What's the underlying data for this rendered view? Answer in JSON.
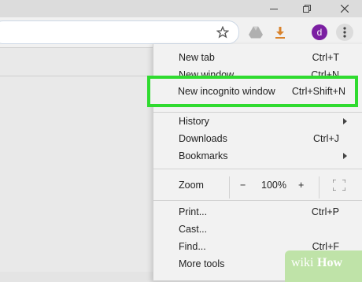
{
  "window": {
    "minimize_icon": "minimize-icon",
    "restore_icon": "restore-icon",
    "close_icon": "close-icon"
  },
  "toolbar": {
    "bookmark_icon": "star-icon",
    "extension_icon": "drive-icon",
    "download_icon": "download-icon",
    "avatar_letter": "d",
    "menu_icon": "kebab-menu-icon"
  },
  "menu": {
    "new_tab": {
      "label": "New tab",
      "shortcut": "Ctrl+T"
    },
    "new_window": {
      "label": "New window",
      "shortcut": "Ctrl+N"
    },
    "new_incognito": {
      "label": "New incognito window",
      "shortcut": "Ctrl+Shift+N"
    },
    "history": {
      "label": "History"
    },
    "downloads": {
      "label": "Downloads",
      "shortcut": "Ctrl+J"
    },
    "bookmarks": {
      "label": "Bookmarks"
    },
    "zoom": {
      "label": "Zoom",
      "minus": "−",
      "value": "100%",
      "plus": "+"
    },
    "print": {
      "label": "Print...",
      "shortcut": "Ctrl+P"
    },
    "cast": {
      "label": "Cast..."
    },
    "find": {
      "label": "Find...",
      "shortcut": "Ctrl+F"
    },
    "more_tools": {
      "label": "More tools"
    }
  },
  "watermark": {
    "wiki": "wiki",
    "how": "How"
  },
  "colors": {
    "highlight": "#2fdb2f",
    "avatar": "#7b1fa2",
    "download": "#d9822b"
  }
}
